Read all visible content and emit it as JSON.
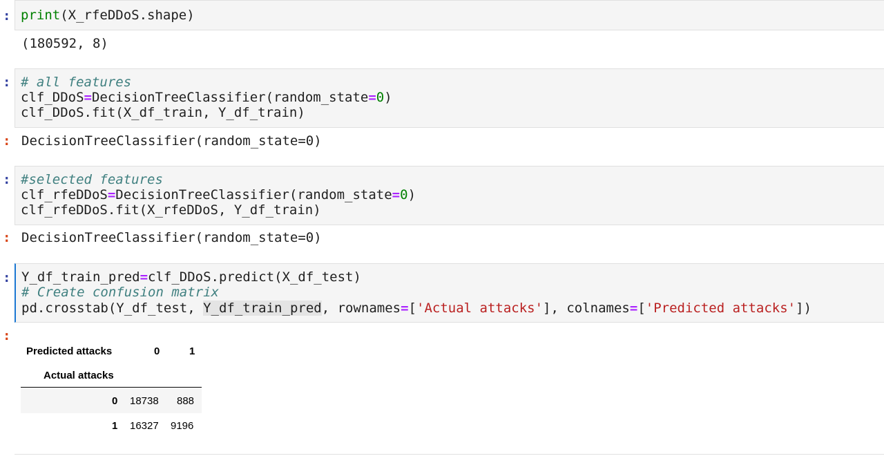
{
  "cells": [
    {
      "prompt": ":",
      "code": {
        "fn": "print",
        "rest": "(X_rfeDDoS.shape)"
      },
      "output": "(180592, 8)"
    },
    {
      "prompt": ":",
      "comment": "# all features",
      "line2": {
        "lhs": "clf_DDoS",
        "op": "=",
        "call": "DecisionTreeClassifier(random_state",
        "op2": "=",
        "num": "0",
        "close": ")"
      },
      "line3": "clf_DDoS.fit(X_df_train, Y_df_train)",
      "out_prompt": ":",
      "output": "DecisionTreeClassifier(random_state=0)"
    },
    {
      "prompt": ":",
      "comment": "#selected features",
      "line2": {
        "lhs": "clf_rfeDDoS",
        "op": "=",
        "call": "DecisionTreeClassifier(random_state",
        "op2": "=",
        "num": "0",
        "close": ")"
      },
      "line3": "clf_rfeDDoS.fit(X_rfeDDoS, Y_df_train)",
      "out_prompt": ":",
      "output": "DecisionTreeClassifier(random_state=0)"
    },
    {
      "prompt": ":",
      "line1": {
        "lhs": "Y_df_train_pred",
        "op": "=",
        "rest": "clf_DDoS.predict(X_df_test)"
      },
      "comment": "# Create confusion matrix",
      "line3": {
        "a": "pd.crosstab(Y_df_test, ",
        "hl": "Y_df_train_pred",
        "b": ", rownames",
        "op": "=",
        "c": "[",
        "s1": "'Actual attacks'",
        "d": "], colnames",
        "op2": "=",
        "e": "[",
        "s2": "'Predicted attacks'",
        "f": "])"
      },
      "out_prompt": ":"
    }
  ],
  "crosstab": {
    "columns_name": "Predicted attacks",
    "index_name": "Actual attacks",
    "columns": [
      "0",
      "1"
    ],
    "rows": [
      {
        "label": "0",
        "values": [
          "18738",
          "888"
        ]
      },
      {
        "label": "1",
        "values": [
          "16327",
          "9196"
        ]
      }
    ]
  },
  "colors": {
    "input_prompt": "#303f9f",
    "output_prompt": "#d84315",
    "comment": "#408080",
    "operator": "#aa22ff",
    "number": "#008000",
    "string": "#ba2121"
  }
}
